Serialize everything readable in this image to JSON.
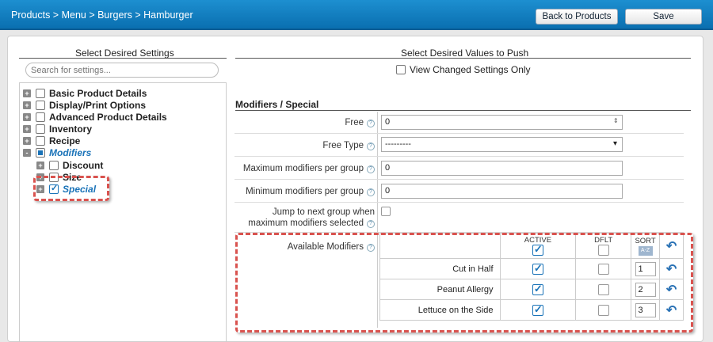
{
  "header": {
    "breadcrumb": "Products > Menu > Burgers > Hamburger",
    "back_label": "Back to Products",
    "save_label": "Save"
  },
  "left": {
    "title": "Select Desired Settings",
    "search_placeholder": "Search for settings...",
    "tree": [
      {
        "label": "Basic Product Details",
        "expander": "+",
        "state": "unchecked"
      },
      {
        "label": "Display/Print Options",
        "expander": "+",
        "state": "unchecked"
      },
      {
        "label": "Advanced Product Details",
        "expander": "+",
        "state": "unchecked"
      },
      {
        "label": "Inventory",
        "expander": "+",
        "state": "unchecked"
      },
      {
        "label": "Recipe",
        "expander": "+",
        "state": "unchecked"
      },
      {
        "label": "Modifiers",
        "expander": "-",
        "state": "partial"
      },
      {
        "label": "Discount",
        "expander": "+",
        "state": "unchecked"
      },
      {
        "label": "Size",
        "expander": "+",
        "state": "unchecked"
      },
      {
        "label": "Special",
        "expander": "+",
        "state": "checked"
      }
    ]
  },
  "right": {
    "title": "Select Desired Values to Push",
    "view_changed_label": "View Changed Settings Only",
    "section_title": "Modifiers / Special",
    "fields": {
      "free_label": "Free",
      "free_value": "0",
      "free_type_label": "Free Type",
      "free_type_value": "---------",
      "max_label": "Maximum modifiers per group",
      "max_value": "0",
      "min_label": "Minimum modifiers per group",
      "min_value": "0",
      "jump_label_1": "Jump to next group when",
      "jump_label_2": "maximum modifiers selected",
      "available_label": "Available Modifiers"
    },
    "modifier_headers": {
      "active": "ACTIVE",
      "dflt": "DFLT",
      "sort": "SORT",
      "sort_btn": "A-Z"
    },
    "modifiers": [
      {
        "name": "Cut in Half",
        "active": true,
        "dflt": false,
        "sort": "1"
      },
      {
        "name": "Peanut Allergy",
        "active": true,
        "dflt": false,
        "sort": "2"
      },
      {
        "name": "Lettuce on the Side",
        "active": true,
        "dflt": false,
        "sort": "3"
      }
    ]
  },
  "colors": {
    "accent": "#1a73b8",
    "highlight": "#d9534f",
    "topbar": "#0a6fb0"
  }
}
